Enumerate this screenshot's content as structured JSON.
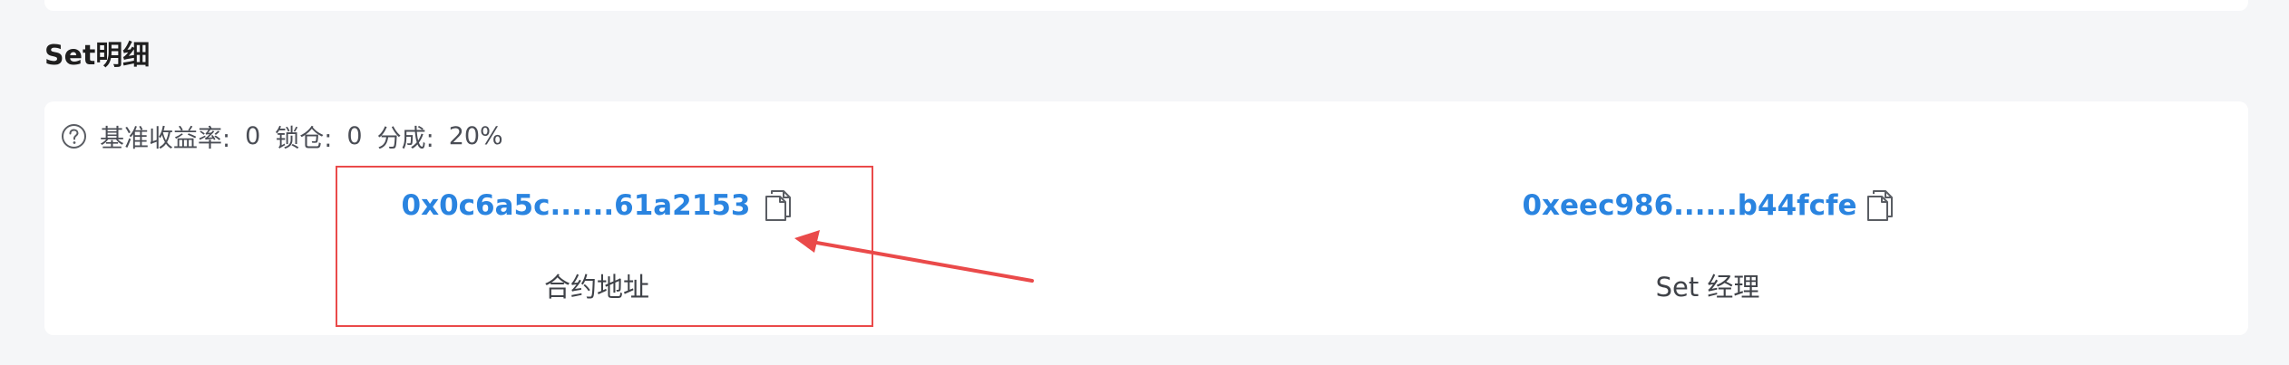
{
  "section": {
    "title": "Set明细"
  },
  "info": {
    "yield_label": "基准收益率:",
    "yield_value": "0",
    "lock_label": "锁仓:",
    "lock_value": "0",
    "share_label": "分成:",
    "share_value": "20%"
  },
  "contract": {
    "address": "0x0c6a5c......61a2153",
    "label": "合约地址"
  },
  "manager": {
    "address": "0xeec986......b44fcfe",
    "label": "Set 经理"
  },
  "colors": {
    "link": "#2a84e0",
    "annotation": "#ea4a4a",
    "background": "#f5f6f8",
    "card": "#ffffff"
  },
  "icons": {
    "help": "question-circle-icon",
    "copy": "copy-document-icon"
  }
}
